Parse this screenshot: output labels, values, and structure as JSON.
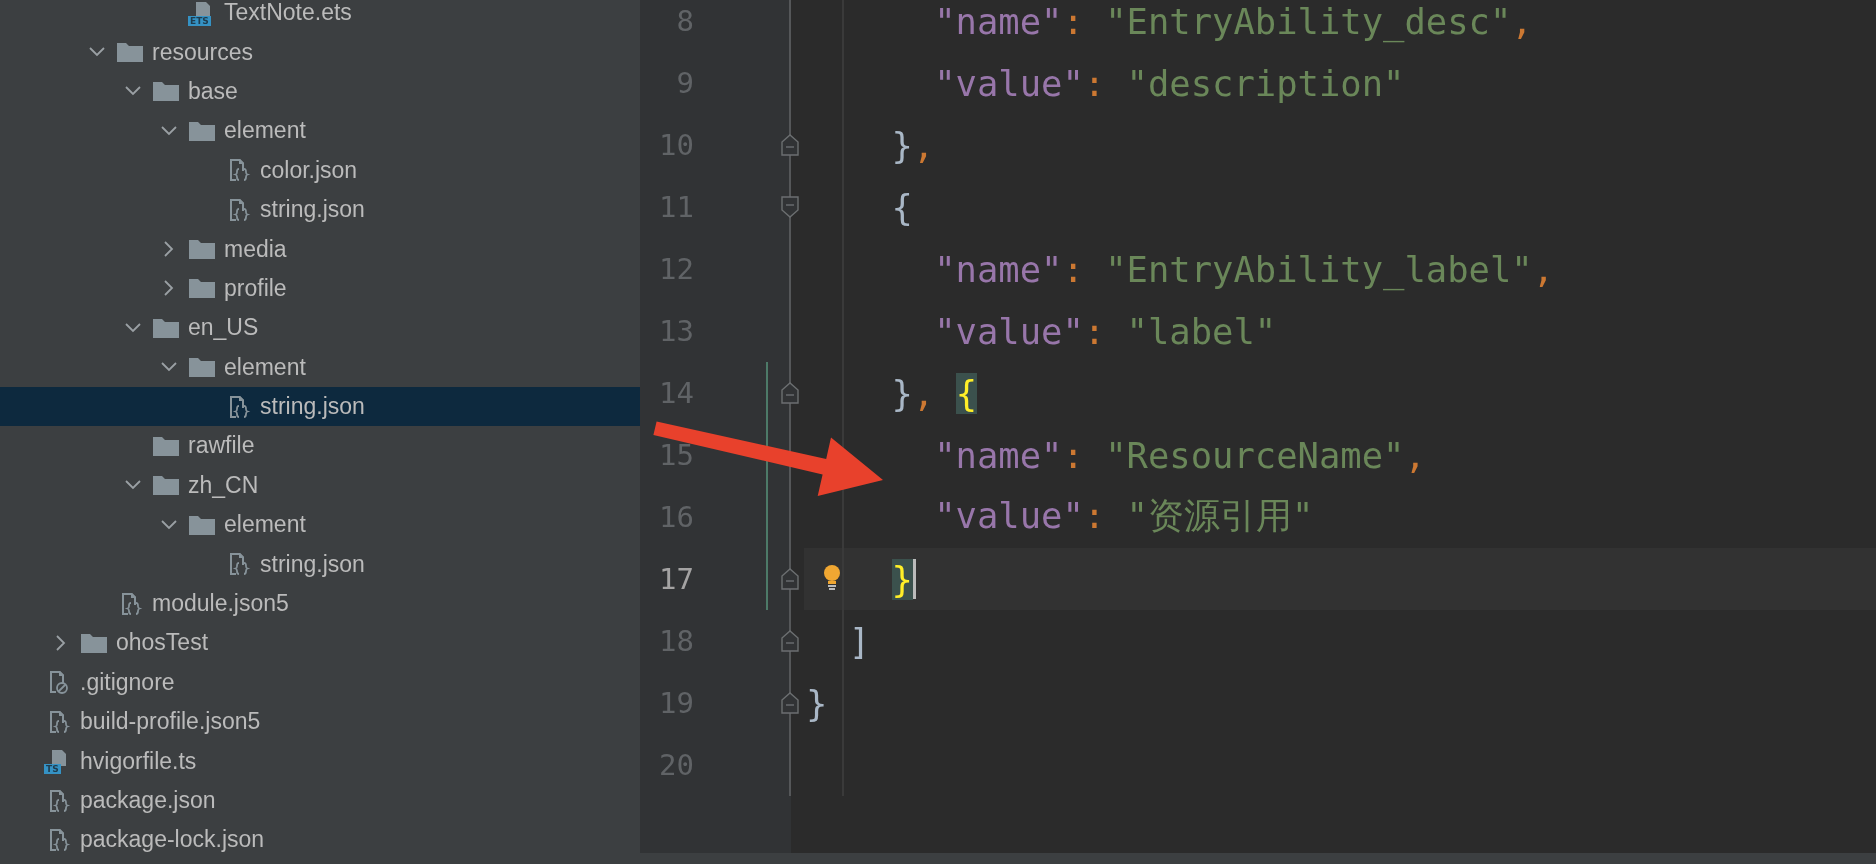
{
  "sidebar": {
    "tree": [
      {
        "children": [
          {
            "children": [
              {
                "children": [
                  {
                    "children": [
                      {
                        "label": "TextNote.ets",
                        "kind": "ets",
                        "badge": "ETS",
                        "selected": false
                      }
                    ]
                  }
                ]
              },
              {
                "label": "resources",
                "kind": "folder",
                "expanded": true,
                "selected": false,
                "children": [
                  {
                    "label": "base",
                    "kind": "folder",
                    "expanded": true,
                    "selected": false,
                    "children": [
                      {
                        "label": "element",
                        "kind": "folder",
                        "expanded": true,
                        "selected": false,
                        "children": [
                          {
                            "label": "color.json",
                            "kind": "json",
                            "selected": false
                          },
                          {
                            "label": "string.json",
                            "kind": "json",
                            "selected": false
                          }
                        ]
                      },
                      {
                        "label": "media",
                        "kind": "folder",
                        "expanded": false,
                        "selected": false
                      },
                      {
                        "label": "profile",
                        "kind": "folder",
                        "expanded": false,
                        "selected": false
                      }
                    ]
                  },
                  {
                    "label": "en_US",
                    "kind": "folder",
                    "expanded": true,
                    "selected": false,
                    "children": [
                      {
                        "label": "element",
                        "kind": "folder",
                        "expanded": true,
                        "selected": false,
                        "children": [
                          {
                            "label": "string.json",
                            "kind": "json",
                            "selected": true
                          }
                        ]
                      }
                    ]
                  },
                  {
                    "label": "rawfile",
                    "kind": "folder",
                    "selected": false
                  },
                  {
                    "label": "zh_CN",
                    "kind": "folder",
                    "expanded": true,
                    "selected": false,
                    "children": [
                      {
                        "label": "element",
                        "kind": "folder",
                        "expanded": true,
                        "selected": false,
                        "children": [
                          {
                            "label": "string.json",
                            "kind": "json",
                            "selected": false
                          }
                        ]
                      }
                    ]
                  }
                ]
              },
              {
                "label": "module.json5",
                "kind": "json",
                "selected": false
              }
            ]
          },
          {
            "label": "ohosTest",
            "kind": "folder",
            "expanded": false,
            "selected": false
          }
        ]
      },
      {
        "label": ".gitignore",
        "kind": "ignore",
        "selected": false
      },
      {
        "label": "build-profile.json5",
        "kind": "json",
        "selected": false
      },
      {
        "label": "hvigorfile.ts",
        "kind": "ts",
        "badge": "TS",
        "selected": false
      },
      {
        "label": "package.json",
        "kind": "json",
        "selected": false
      },
      {
        "label": "package-lock.json",
        "kind": "json",
        "selected": false
      }
    ]
  },
  "editor": {
    "lines": [
      {
        "number": "8",
        "tokens": [
          {
            "text": "      \"name\"",
            "kind": "key"
          },
          {
            "text": ": ",
            "kind": "punct"
          },
          {
            "text": "\"EntryAbility_desc\"",
            "kind": "string"
          },
          {
            "text": ",",
            "kind": "punct"
          }
        ],
        "fold_start": false,
        "fold_end": false,
        "changed": false,
        "current": false,
        "caret": false,
        "bulb": false
      },
      {
        "number": "9",
        "tokens": [
          {
            "text": "      \"value\"",
            "kind": "key"
          },
          {
            "text": ": ",
            "kind": "punct"
          },
          {
            "text": "\"description\"",
            "kind": "string"
          }
        ],
        "fold_start": false,
        "fold_end": false,
        "changed": false,
        "current": false,
        "caret": false,
        "bulb": false
      },
      {
        "number": "10",
        "tokens": [
          {
            "text": "    }",
            "kind": "brace"
          },
          {
            "text": ",",
            "kind": "punct"
          }
        ],
        "fold_start": false,
        "fold_end": true,
        "changed": false,
        "current": false,
        "caret": false,
        "bulb": false
      },
      {
        "number": "11",
        "tokens": [
          {
            "text": "    {",
            "kind": "brace"
          }
        ],
        "fold_start": true,
        "fold_end": false,
        "changed": false,
        "current": false,
        "caret": false,
        "bulb": false
      },
      {
        "number": "12",
        "tokens": [
          {
            "text": "      \"name\"",
            "kind": "key"
          },
          {
            "text": ": ",
            "kind": "punct"
          },
          {
            "text": "\"EntryAbility_label\"",
            "kind": "string"
          },
          {
            "text": ",",
            "kind": "punct"
          }
        ],
        "fold_start": false,
        "fold_end": false,
        "changed": false,
        "current": false,
        "caret": false,
        "bulb": false
      },
      {
        "number": "13",
        "tokens": [
          {
            "text": "      \"value\"",
            "kind": "key"
          },
          {
            "text": ": ",
            "kind": "punct"
          },
          {
            "text": "\"label\"",
            "kind": "string"
          }
        ],
        "fold_start": false,
        "fold_end": false,
        "changed": false,
        "current": false,
        "caret": false,
        "bulb": false
      },
      {
        "number": "14",
        "tokens": [
          {
            "text": "    }",
            "kind": "brace"
          },
          {
            "text": ", ",
            "kind": "punct"
          },
          {
            "text": "{",
            "kind": "match"
          }
        ],
        "fold_start": false,
        "fold_end": true,
        "changed": true,
        "current": false,
        "caret": false,
        "bulb": false
      },
      {
        "number": "15",
        "tokens": [
          {
            "text": "      \"name\"",
            "kind": "key"
          },
          {
            "text": ": ",
            "kind": "punct"
          },
          {
            "text": "\"ResourceName\"",
            "kind": "string"
          },
          {
            "text": ",",
            "kind": "punct"
          }
        ],
        "fold_start": false,
        "fold_end": false,
        "changed": true,
        "current": false,
        "caret": false,
        "bulb": false
      },
      {
        "number": "16",
        "tokens": [
          {
            "text": "      \"value\"",
            "kind": "key"
          },
          {
            "text": ": ",
            "kind": "punct"
          },
          {
            "text": "\"资源引用\"",
            "kind": "string"
          }
        ],
        "fold_start": false,
        "fold_end": false,
        "changed": true,
        "current": false,
        "caret": false,
        "bulb": false
      },
      {
        "number": "17",
        "tokens": [
          {
            "text": "    }",
            "kind": "match"
          }
        ],
        "fold_start": false,
        "fold_end": true,
        "changed": true,
        "current": true,
        "caret": true,
        "bulb": true
      },
      {
        "number": "18",
        "tokens": [
          {
            "text": "  ]",
            "kind": "brace"
          }
        ],
        "fold_start": false,
        "fold_end": true,
        "changed": false,
        "current": false,
        "caret": false,
        "bulb": false
      },
      {
        "number": "19",
        "tokens": [
          {
            "text": "}",
            "kind": "brace"
          }
        ],
        "fold_start": false,
        "fold_end": true,
        "changed": false,
        "current": false,
        "caret": false,
        "bulb": false
      },
      {
        "number": "20",
        "fold_start": false,
        "fold_end": false,
        "changed": false,
        "current": false,
        "caret": false,
        "bulb": false
      }
    ]
  },
  "annotations": [
    {
      "kind": "arrow"
    }
  ]
}
